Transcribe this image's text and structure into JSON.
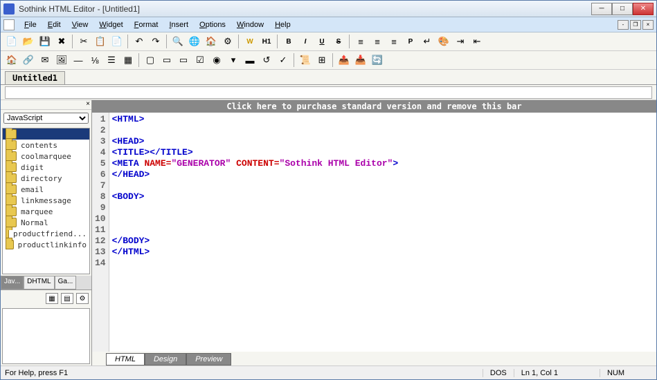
{
  "app_title": "Sothink HTML Editor - [Untitled1]",
  "menus": [
    "File",
    "Edit",
    "View",
    "Widget",
    "Format",
    "Insert",
    "Options",
    "Window",
    "Help"
  ],
  "doctab": "Untitled1",
  "banner": "Click here to purchase standard version and remove this bar",
  "sidebar": {
    "dropdown": "JavaScript",
    "items": [
      "",
      "contents",
      "coolmarquee",
      "digit",
      "directory",
      "email",
      "linkmessage",
      "marquee",
      "Normal",
      "productfriend...",
      "productlinkinfo"
    ],
    "tabs": [
      "Jav...",
      "DHTML",
      "Ga..."
    ]
  },
  "code_lines": [
    {
      "n": 1,
      "html": "<span class='tag'>&lt;HTML&gt;</span>"
    },
    {
      "n": 2,
      "html": ""
    },
    {
      "n": 3,
      "html": "<span class='tag'>&lt;HEAD&gt;</span>"
    },
    {
      "n": 4,
      "html": "<span class='tag'>&lt;TITLE&gt;&lt;/TITLE&gt;</span>"
    },
    {
      "n": 5,
      "html": "<span class='tag'>&lt;META</span> <span class='attr'>NAME=</span><span class='str'>\"GENERATOR\"</span> <span class='attr'>CONTENT=</span><span class='str'>\"Sothink HTML Editor\"</span><span class='tag'>&gt;</span>"
    },
    {
      "n": 6,
      "html": "<span class='tag'>&lt;/HEAD&gt;</span>"
    },
    {
      "n": 7,
      "html": ""
    },
    {
      "n": 8,
      "html": "<span class='tag'>&lt;BODY&gt;</span>"
    },
    {
      "n": 9,
      "html": ""
    },
    {
      "n": 10,
      "html": ""
    },
    {
      "n": 11,
      "html": ""
    },
    {
      "n": 12,
      "html": "<span class='tag'>&lt;/BODY&gt;</span>"
    },
    {
      "n": 13,
      "html": "<span class='tag'>&lt;/HTML&gt;</span>"
    },
    {
      "n": 14,
      "html": ""
    }
  ],
  "edit_tabs": [
    "HTML",
    "Design",
    "Preview"
  ],
  "toolbar_labels": {
    "w": "W",
    "h1": "H1",
    "p": "P",
    "b": "B",
    "i": "I",
    "u": "U",
    "s": "S"
  },
  "status": {
    "help": "For Help, press F1",
    "mode": "DOS",
    "pos": "Ln 1, Col 1",
    "num": "NUM"
  }
}
